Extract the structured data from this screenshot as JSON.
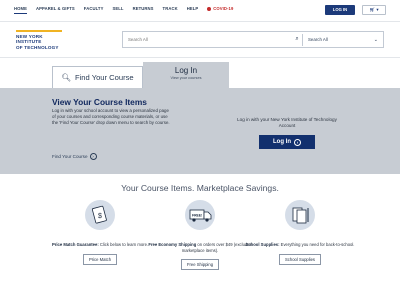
{
  "nav": {
    "links": [
      "HOME",
      "APPAREL & GIFTS",
      "FACULTY",
      "SELL",
      "RETURNS",
      "TRACK",
      "HELP",
      "COVID-19"
    ],
    "login_label": "LOG IN",
    "cart_icon": "cart-icon"
  },
  "header": {
    "logo_line1": "NEW YORK INSTITUTE",
    "logo_line2": "OF TECHNOLOGY",
    "search_placeholder": "Search All",
    "search_scope": "Search All"
  },
  "tabs": {
    "find_label": "Find Your Course",
    "login_label": "Log In",
    "login_sub": "View your courses"
  },
  "panel": {
    "title": "View Your Course Items",
    "description": "Log in with your school account to view a personalized page of your courses and corresponding course materials, or use the 'Find Your Course' drop down menu to search by course.",
    "find_link": "Find Your Course",
    "login_message": "Log in with your New York Institute of Technology Account",
    "login_button": "Log In"
  },
  "market": {
    "title": "Your Course Items. Marketplace Savings.",
    "features": [
      {
        "bold": "Price Match Guarantee:",
        "text": " Click below to learn more.",
        "button": "Price Match"
      },
      {
        "bold": "Free Economy Shipping",
        "text": " on orders over $49 (excludes marketplace items).",
        "button": "Free Shipping"
      },
      {
        "bold": "School Supplies:",
        "text": " Everything you need for back-to-school.",
        "button": "School Supplies"
      }
    ]
  },
  "colors": {
    "brand": "#1c3a7a",
    "accent": "#f0b323",
    "panel": "#c7ccd3",
    "covid": "#c42a2a"
  }
}
